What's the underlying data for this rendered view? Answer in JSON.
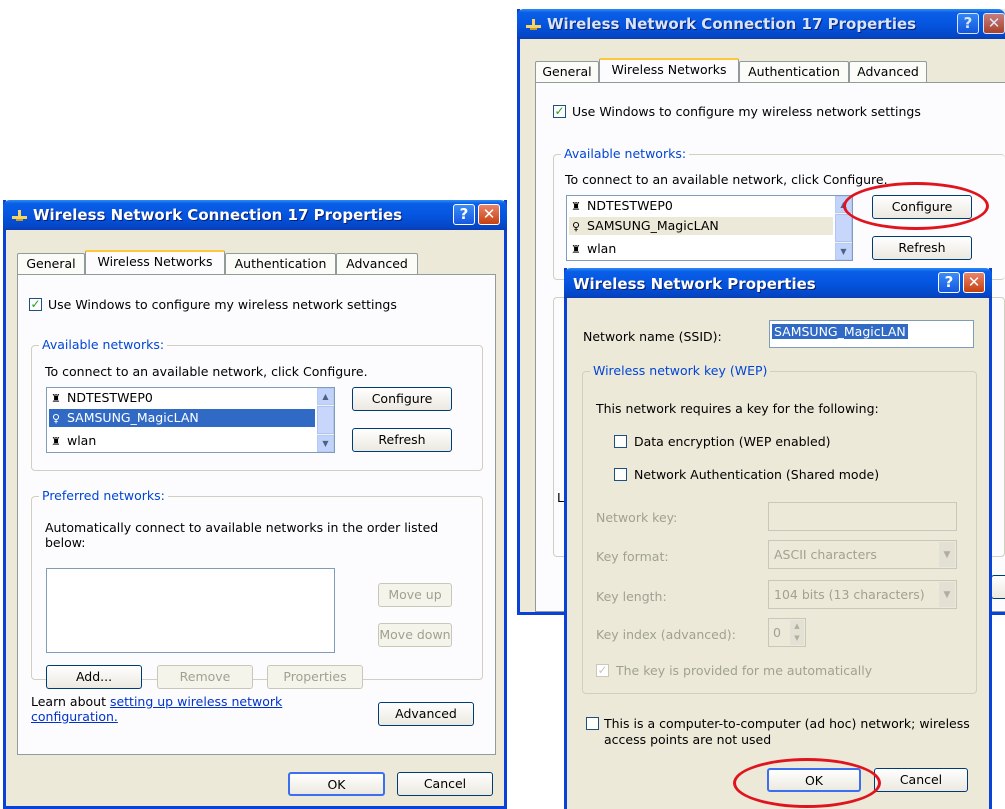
{
  "left_dialog": {
    "title": "Wireless Network Connection 17 Properties",
    "tabs": [
      "General",
      "Wireless Networks",
      "Authentication",
      "Advanced"
    ],
    "use_windows": "Use Windows to configure my wireless network settings",
    "available": {
      "title": "Available networks:",
      "hint": "To connect to an available network, click Configure.",
      "networks": [
        "NDTESTWEP0",
        "SAMSUNG_MagicLAN",
        "wlan"
      ],
      "configure": "Configure",
      "refresh": "Refresh"
    },
    "preferred": {
      "title": "Preferred networks:",
      "hint": "Automatically connect to available networks in the order listed below:",
      "move_up": "Move up",
      "move_down": "Move down",
      "add": "Add...",
      "remove": "Remove",
      "properties": "Properties"
    },
    "learn_prefix": "Learn about ",
    "learn_link_1": "setting up wireless network",
    "learn_link_2": "configuration.",
    "advanced": "Advanced",
    "ok": "OK",
    "cancel": "Cancel"
  },
  "right_dialog": {
    "title": "Wireless Network Connection 17 Properties",
    "tabs": [
      "General",
      "Wireless Networks",
      "Authentication",
      "Advanced"
    ],
    "use_windows": "Use Windows to configure my wireless network settings",
    "available": {
      "title": "Available networks:",
      "hint": "To connect to an available network, click Configure.",
      "networks": [
        "NDTESTWEP0",
        "SAMSUNG_MagicLAN",
        "wlan"
      ],
      "configure": "Configure",
      "refresh": "Refresh"
    },
    "partial_l": "L"
  },
  "wnp_dialog": {
    "title": "Wireless Network Properties",
    "ssid_label": "Network name (SSID):",
    "ssid_value": "SAMSUNG_MagicLAN",
    "wep_group": "Wireless network key (WEP)",
    "requires": "This network requires a key for the following:",
    "data_enc": "Data encryption (WEP enabled)",
    "net_auth": "Network Authentication (Shared mode)",
    "network_key": "Network key:",
    "key_format": "Key format:",
    "key_format_value": "ASCII characters",
    "key_length": "Key length:",
    "key_length_value": "104 bits (13 characters)",
    "key_index": "Key index (advanced):",
    "key_index_value": "0",
    "auto_key": "The key is provided for me automatically",
    "adhoc_1": "This is a computer-to-computer (ad hoc) network; wireless",
    "adhoc_2": "access points are not used",
    "ok": "OK",
    "cancel": "Cancel"
  },
  "colors": {
    "titlebar": "#0555e0",
    "dialog_bg": "#ece9d8",
    "highlight": "#316ac5",
    "annotation_ring": "#e0141e"
  },
  "icons": {
    "title_icon": "network-connection-icon",
    "network_icon": "wireless-antenna-icon"
  }
}
